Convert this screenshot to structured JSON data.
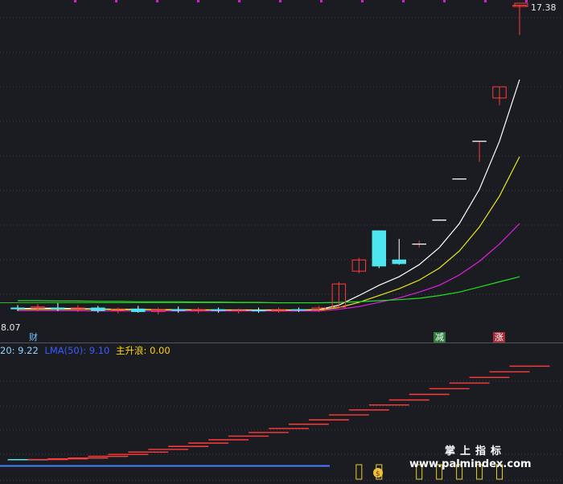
{
  "price_labels": {
    "high": "17.38",
    "low": "8.07"
  },
  "signals": {
    "cai": "财",
    "jian": "减",
    "zhang": "涨"
  },
  "indicator_bar": [
    {
      "text": "20: 9.22",
      "color": "#8fd3ff"
    },
    {
      "text": "LMA(50): 9.10",
      "color": "#3a5bff"
    },
    {
      "text": "主升浪: 0.00",
      "color": "#ffd400"
    }
  ],
  "watermark": {
    "title": "掌上指标",
    "url": "www.palmindex.com"
  },
  "colors": {
    "up": "#ff3b3b",
    "down": "#4de6f0",
    "ma_white": "#ffffff",
    "ma_yellow": "#e8e820",
    "ma_magenta": "#e020e0",
    "ma_green": "#20e020",
    "ref_green": "#20c020"
  },
  "chart_data": {
    "type": "candlestick",
    "price_range": [
      8.07,
      17.38
    ],
    "candles": [
      {
        "o": 8.55,
        "h": 8.62,
        "l": 8.45,
        "c": 8.5
      },
      {
        "o": 8.52,
        "h": 8.65,
        "l": 8.45,
        "c": 8.58
      },
      {
        "o": 8.55,
        "h": 8.68,
        "l": 8.45,
        "c": 8.5
      },
      {
        "o": 8.5,
        "h": 8.62,
        "l": 8.42,
        "c": 8.55
      },
      {
        "o": 8.55,
        "h": 8.6,
        "l": 8.4,
        "c": 8.45
      },
      {
        "o": 8.45,
        "h": 8.55,
        "l": 8.38,
        "c": 8.52
      },
      {
        "o": 8.52,
        "h": 8.6,
        "l": 8.4,
        "c": 8.42
      },
      {
        "o": 8.42,
        "h": 8.55,
        "l": 8.35,
        "c": 8.5
      },
      {
        "o": 8.5,
        "h": 8.58,
        "l": 8.4,
        "c": 8.45
      },
      {
        "o": 8.45,
        "h": 8.55,
        "l": 8.38,
        "c": 8.5
      },
      {
        "o": 8.5,
        "h": 8.55,
        "l": 8.4,
        "c": 8.45
      },
      {
        "o": 8.45,
        "h": 8.52,
        "l": 8.38,
        "c": 8.48
      },
      {
        "o": 8.48,
        "h": 8.55,
        "l": 8.4,
        "c": 8.44
      },
      {
        "o": 8.44,
        "h": 8.55,
        "l": 8.4,
        "c": 8.5
      },
      {
        "o": 8.5,
        "h": 8.55,
        "l": 8.42,
        "c": 8.46
      },
      {
        "o": 8.46,
        "h": 8.6,
        "l": 8.42,
        "c": 8.55
      },
      {
        "o": 8.55,
        "h": 9.3,
        "l": 8.55,
        "c": 9.25
      },
      {
        "o": 9.6,
        "h": 10.0,
        "l": 9.55,
        "c": 9.95
      },
      {
        "o": 10.8,
        "h": 10.8,
        "l": 9.7,
        "c": 9.75
      },
      {
        "o": 9.95,
        "h": 10.55,
        "l": 9.8,
        "c": 9.82
      },
      {
        "o": 10.4,
        "h": 10.5,
        "l": 10.3,
        "c": 10.4
      },
      {
        "o": 11.1,
        "h": 11.1,
        "l": 11.1,
        "c": 11.1
      },
      {
        "o": 12.3,
        "h": 12.3,
        "l": 12.3,
        "c": 12.3
      },
      {
        "o": 13.4,
        "h": 13.4,
        "l": 12.8,
        "c": 13.4
      },
      {
        "o": 14.65,
        "h": 15.0,
        "l": 14.45,
        "c": 15.0
      },
      {
        "o": 17.32,
        "h": 17.38,
        "l": 16.5,
        "c": 17.38
      }
    ],
    "moving_averages": [
      {
        "color": "#ffffff",
        "values": [
          8.52,
          8.53,
          8.53,
          8.52,
          8.51,
          8.5,
          8.5,
          8.49,
          8.49,
          8.48,
          8.48,
          8.48,
          8.48,
          8.48,
          8.48,
          8.49,
          8.62,
          8.9,
          9.2,
          9.45,
          9.8,
          10.3,
          11.0,
          12.0,
          13.4,
          15.2
        ]
      },
      {
        "color": "#e8e820",
        "values": [
          8.5,
          8.5,
          8.5,
          8.5,
          8.5,
          8.49,
          8.49,
          8.49,
          8.48,
          8.48,
          8.48,
          8.47,
          8.47,
          8.47,
          8.47,
          8.48,
          8.55,
          8.7,
          8.9,
          9.1,
          9.35,
          9.7,
          10.2,
          10.9,
          11.8,
          12.95
        ]
      },
      {
        "color": "#e020e0",
        "values": [
          8.46,
          8.46,
          8.46,
          8.46,
          8.45,
          8.45,
          8.45,
          8.45,
          8.45,
          8.45,
          8.45,
          8.45,
          8.45,
          8.45,
          8.45,
          8.45,
          8.5,
          8.58,
          8.7,
          8.83,
          9.0,
          9.2,
          9.5,
          9.9,
          10.4,
          11.0
        ]
      },
      {
        "color": "#20e020",
        "values": [
          8.75,
          8.75,
          8.74,
          8.74,
          8.73,
          8.73,
          8.72,
          8.72,
          8.72,
          8.71,
          8.71,
          8.7,
          8.7,
          8.69,
          8.69,
          8.69,
          8.7,
          8.72,
          8.75,
          8.78,
          8.82,
          8.9,
          9.0,
          9.15,
          9.3,
          9.45
        ]
      }
    ],
    "indicator_levels": [
      0.0,
      0.05,
      0.25,
      0.5,
      1.0,
      1.6,
      2.3,
      3.1,
      4.0,
      5.0,
      6.0,
      7.1,
      8.2,
      9.4,
      10.7,
      12.0,
      13.5,
      15.0,
      16.5,
      18.0,
      19.7,
      21.4,
      23.1,
      24.8,
      26.5,
      28.2
    ],
    "indicator_range": [
      -2,
      30
    ],
    "markers": [
      false,
      false,
      false,
      false,
      false,
      false,
      false,
      false,
      false,
      false,
      false,
      false,
      false,
      false,
      false,
      false,
      false,
      true,
      true,
      false,
      true,
      true,
      true,
      true,
      true,
      false
    ]
  }
}
